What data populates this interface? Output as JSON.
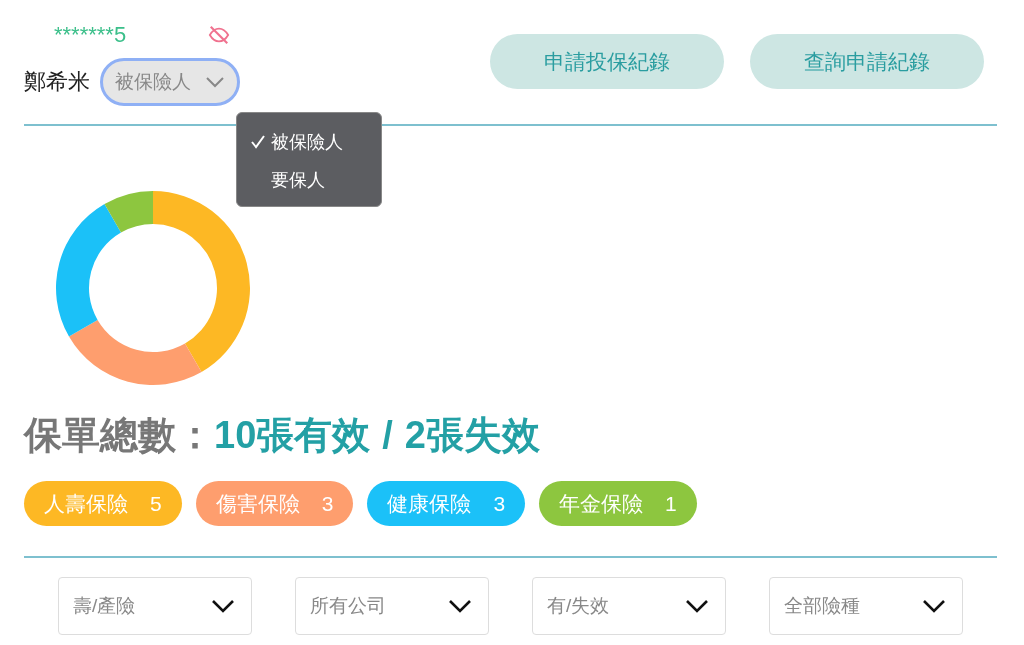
{
  "account": {
    "masked_id": "*******5"
  },
  "person": {
    "name": "鄭希米",
    "role_select": {
      "value": "被保險人",
      "focused": true
    }
  },
  "role_menu": {
    "options": [
      {
        "label": "被保險人",
        "selected": true
      },
      {
        "label": "要保人",
        "selected": false
      }
    ]
  },
  "buttons": [
    "申請投保紀錄",
    "查詢申請紀錄"
  ],
  "summary": {
    "label": "保單總數：",
    "valid": "10張有效",
    "separator": "/",
    "invalid": "2張失效"
  },
  "categories": [
    {
      "label": "人壽保險",
      "count": "5",
      "color": "#fdb824"
    },
    {
      "label": "傷害保險",
      "count": "3",
      "color": "#fe9e6e"
    },
    {
      "label": "健康保險",
      "count": "3",
      "color": "#1bc1f8"
    },
    {
      "label": "年金保險",
      "count": "1",
      "color": "#8dc63f"
    }
  ],
  "filters": [
    {
      "value": "壽/產險"
    },
    {
      "value": "所有公司"
    },
    {
      "value": "有/失效"
    },
    {
      "value": "全部險種"
    }
  ]
}
